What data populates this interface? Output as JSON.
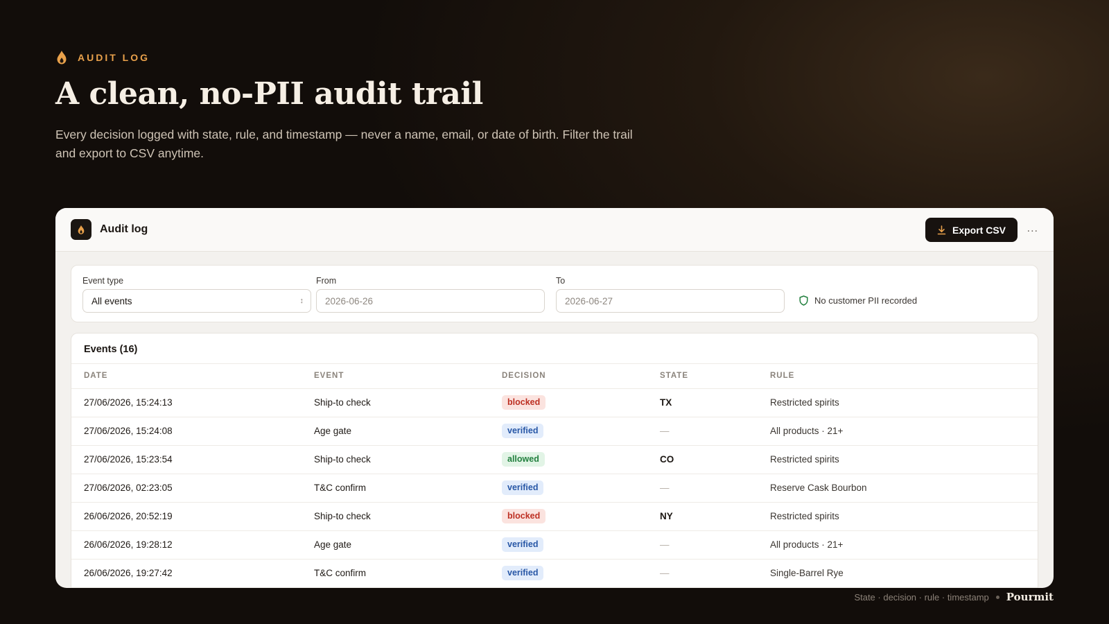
{
  "hero": {
    "eyebrow": "AUDIT LOG",
    "headline": "A clean, no-PII audit trail",
    "subtext": "Every decision logged with state, rule, and timestamp — never a name, email, or date of birth. Filter the trail and export to CSV anytime."
  },
  "panel": {
    "app_title": "Audit log",
    "app_icon": "flame-icon",
    "export_label": "Export CSV",
    "export_icon": "download-icon",
    "more_label": "..."
  },
  "filters": {
    "event_type_label": "Event type",
    "event_type_value": "All events",
    "from_label": "From",
    "from_placeholder": "2026-06-26",
    "to_label": "To",
    "to_placeholder": "2026-06-27",
    "pii_note": "No customer PII recorded",
    "pii_icon": "shield-icon"
  },
  "events": {
    "title": "Events (16)",
    "columns": [
      "DATE",
      "EVENT",
      "DECISION",
      "STATE",
      "RULE"
    ],
    "rows": [
      {
        "date": "27/06/2026, 15:24:13",
        "event": "Ship-to check",
        "decision": "blocked",
        "state": "TX",
        "rule": "Restricted spirits"
      },
      {
        "date": "27/06/2026, 15:24:08",
        "event": "Age gate",
        "decision": "verified",
        "state": "—",
        "rule": "All products · 21+"
      },
      {
        "date": "27/06/2026, 15:23:54",
        "event": "Ship-to check",
        "decision": "allowed",
        "state": "CO",
        "rule": "Restricted spirits"
      },
      {
        "date": "27/06/2026, 02:23:05",
        "event": "T&C confirm",
        "decision": "verified",
        "state": "—",
        "rule": "Reserve Cask Bourbon"
      },
      {
        "date": "26/06/2026, 20:52:19",
        "event": "Ship-to check",
        "decision": "blocked",
        "state": "NY",
        "rule": "Restricted spirits"
      },
      {
        "date": "26/06/2026, 19:28:12",
        "event": "Age gate",
        "decision": "verified",
        "state": "—",
        "rule": "All products · 21+"
      },
      {
        "date": "26/06/2026, 19:27:42",
        "event": "T&C confirm",
        "decision": "verified",
        "state": "—",
        "rule": "Single-Barrel Rye"
      }
    ]
  },
  "footer": {
    "caption": "State · decision · rule · timestamp",
    "brand": "Pourmit"
  },
  "colors": {
    "accent": "#e9a14b",
    "blocked": "#bd2f22",
    "verified": "#2857a6",
    "allowed": "#23803f"
  }
}
